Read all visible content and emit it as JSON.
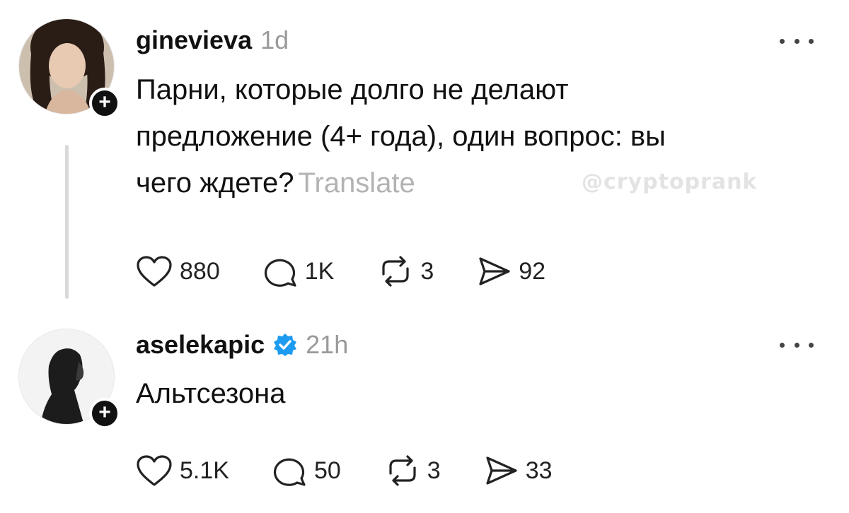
{
  "posts": [
    {
      "username": "ginevieva",
      "time": "1d",
      "text_lines": [
        "Парни, которые долго не делают",
        "предложение (4+ года), один вопрос: вы",
        "чего ждете?"
      ],
      "translate_label": "Translate",
      "verified": false,
      "stats": {
        "likes": "880",
        "replies": "1K",
        "reposts": "3",
        "shares": "92"
      }
    },
    {
      "username": "aselekapic",
      "time": "21h",
      "text_lines": [
        "Альтсезона"
      ],
      "verified": true,
      "stats": {
        "likes": "5.1K",
        "replies": "50",
        "reposts": "3",
        "shares": "33"
      }
    }
  ],
  "follow_label": "+",
  "watermark": "@cryptoprank",
  "icons": {
    "like": "heart-icon",
    "reply": "comment-icon",
    "repost": "repost-icon",
    "share": "send-icon",
    "more": "more-dots-icon",
    "verified": "verified-badge-icon"
  },
  "colors": {
    "verified": "#1d9bf0",
    "muted": "#9a9a9a",
    "thread_line": "#d9d9d9"
  }
}
